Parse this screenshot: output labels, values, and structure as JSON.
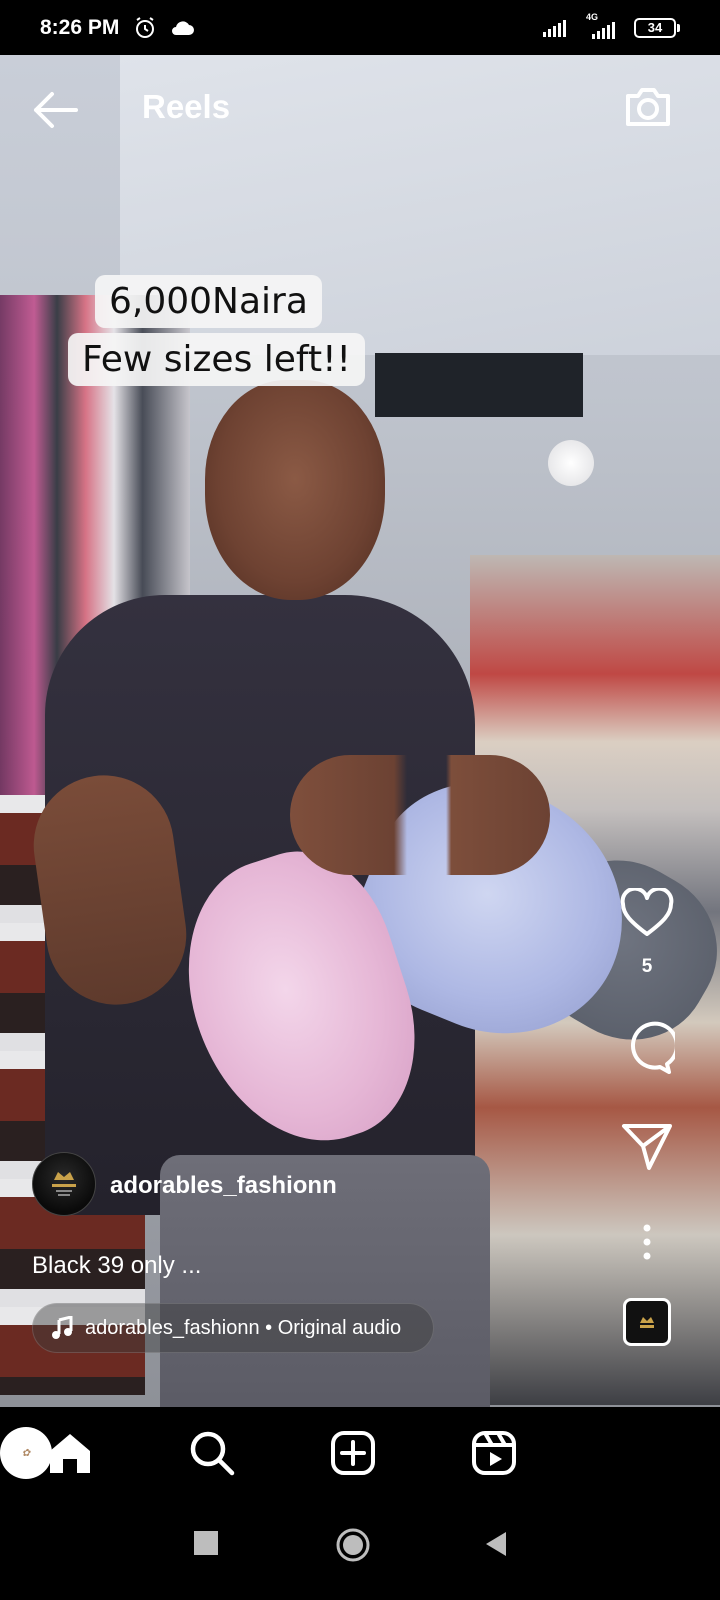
{
  "status_bar": {
    "time": "8:26 PM",
    "network_label": "4G",
    "battery": "34",
    "icons": [
      "alarm-icon",
      "cloud-icon",
      "signal-icon",
      "signal-4g-icon",
      "battery-icon"
    ]
  },
  "header": {
    "title": "Reels",
    "back_icon": "arrow-left-icon",
    "camera_icon": "camera-icon"
  },
  "video": {
    "overlay_line1": "6,000Naira",
    "overlay_line2": "Few sizes left!!"
  },
  "actions": {
    "like_icon": "heart-icon",
    "like_count": "5",
    "comment_icon": "comment-icon",
    "share_icon": "send-icon",
    "more_icon": "more-vertical-icon"
  },
  "post": {
    "author": "adorables_fashionn",
    "caption": "Black 39 only ...",
    "audio": "adorables_fashionn • Original audio"
  },
  "bottom_nav": {
    "items": [
      "home-icon",
      "search-icon",
      "add-post-icon",
      "reels-icon",
      "profile-avatar"
    ],
    "active": "reels-icon"
  },
  "android_nav": [
    "recents-icon",
    "home-icon",
    "back-icon"
  ],
  "colors": {
    "background": "#000000",
    "text": "#ffffff",
    "sticker_bg": "#f5f5f5",
    "sticker_text": "#111111"
  }
}
